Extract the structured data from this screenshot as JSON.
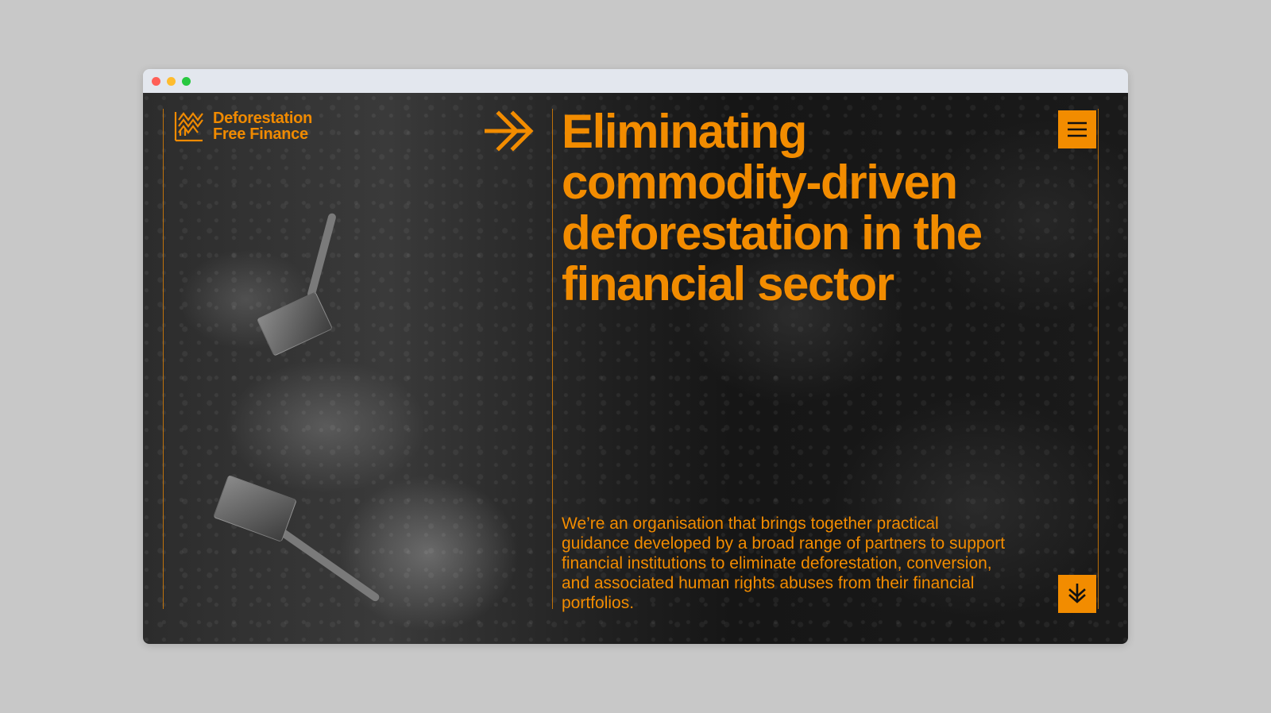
{
  "browser": {
    "window_controls": [
      "close",
      "minimize",
      "maximize"
    ]
  },
  "site": {
    "logo": {
      "icon": "deforestation-free-finance-logo-icon",
      "line1": "Deforestation",
      "line2": "Free Finance"
    },
    "headline_arrow_icon": "double-arrow-right-icon",
    "headline": "Eliminating commodity-driven deforestation in the financial sector",
    "intro": "We’re an organisation that brings together practical guidance developed by a broad range of partners to support financial institutions to eliminate deforestation, conversion, and associated human rights abuses from their financial portfolios.",
    "menu_icon": "hamburger-menu-icon",
    "scroll_icon": "double-chevron-down-icon",
    "background_image": "aerial black-and-white photo of excavators clearing forest land"
  },
  "colors": {
    "accent": "#f28c00",
    "background_page": "#c8c8c8",
    "chrome": "#e3e7ee",
    "dot_red": "#ff5f57",
    "dot_yellow": "#febc2e",
    "dot_green": "#28c840"
  }
}
